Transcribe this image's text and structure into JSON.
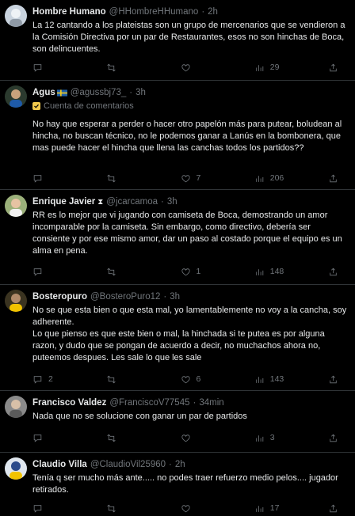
{
  "tweets": [
    {
      "name": "Hombre Humano",
      "handle": "@HHombreHHumano",
      "time": "2h",
      "text": "La 12 cantando a los plateistas son un grupo de mercenarios que se vendieron a la Comisión Directiva por un par de Restaurantes, esos no son hinchas de Boca, son delincuentes.",
      "replies": "",
      "retweets": "",
      "likes": "",
      "views": "29"
    },
    {
      "name": "Agus",
      "handle": "@agussbj73_",
      "time": "3h",
      "subtitle": "Cuenta de comentarios",
      "text": "No hay que esperar a perder o hacer otro papelón más para putear, boludean al hincha, no buscan técnico, no le podemos ganar a Lanús en la bombonera, que mas puede hacer el hincha que llena las canchas todos los partidos??",
      "replies": "",
      "retweets": "",
      "likes": "7",
      "views": "206"
    },
    {
      "name": "Enrique Javier",
      "handle": "@jcarcamoa",
      "time": "3h",
      "text": "RR es lo mejor que vi jugando con camiseta de Boca, demostrando un amor incomparable por la camiseta. Sin embargo, como directivo, debería ser consiente y por ese mismo amor, dar un paso al costado porque el equipo es un alma en pena.",
      "replies": "",
      "retweets": "",
      "likes": "1",
      "views": "148"
    },
    {
      "name": "Bosteropuro",
      "handle": "@BosteroPuro12",
      "time": "3h",
      "text": "No se que esta bien o que esta mal, yo lamentablemente no voy a la cancha, soy adherente.\nLo que pienso es que este bien o mal, la hinchada si te putea es por alguna razon, y dudo que se pongan de acuerdo a decir, no muchachos ahora no, puteemos despues. Les sale lo que les sale",
      "replies": "2",
      "retweets": "",
      "likes": "6",
      "views": "143"
    },
    {
      "name": "Francisco Valdez",
      "handle": "@FranciscoV77545",
      "time": "34min",
      "text": "Nada que no se solucione con ganar un par de partidos",
      "replies": "",
      "retweets": "",
      "likes": "",
      "views": "3"
    },
    {
      "name": "Claudio Villa",
      "handle": "@ClaudioVil25960",
      "time": "2h",
      "text": "Tenía q ser mucho más ante.....  no podes traer refuerzo medio pelos.... jugador retirados.",
      "replies": "",
      "retweets": "",
      "likes": "",
      "views": "17"
    }
  ],
  "colors": {
    "background": "#000000",
    "text": "#e7e9ea",
    "muted": "#71767b",
    "divider": "#2f3336"
  }
}
